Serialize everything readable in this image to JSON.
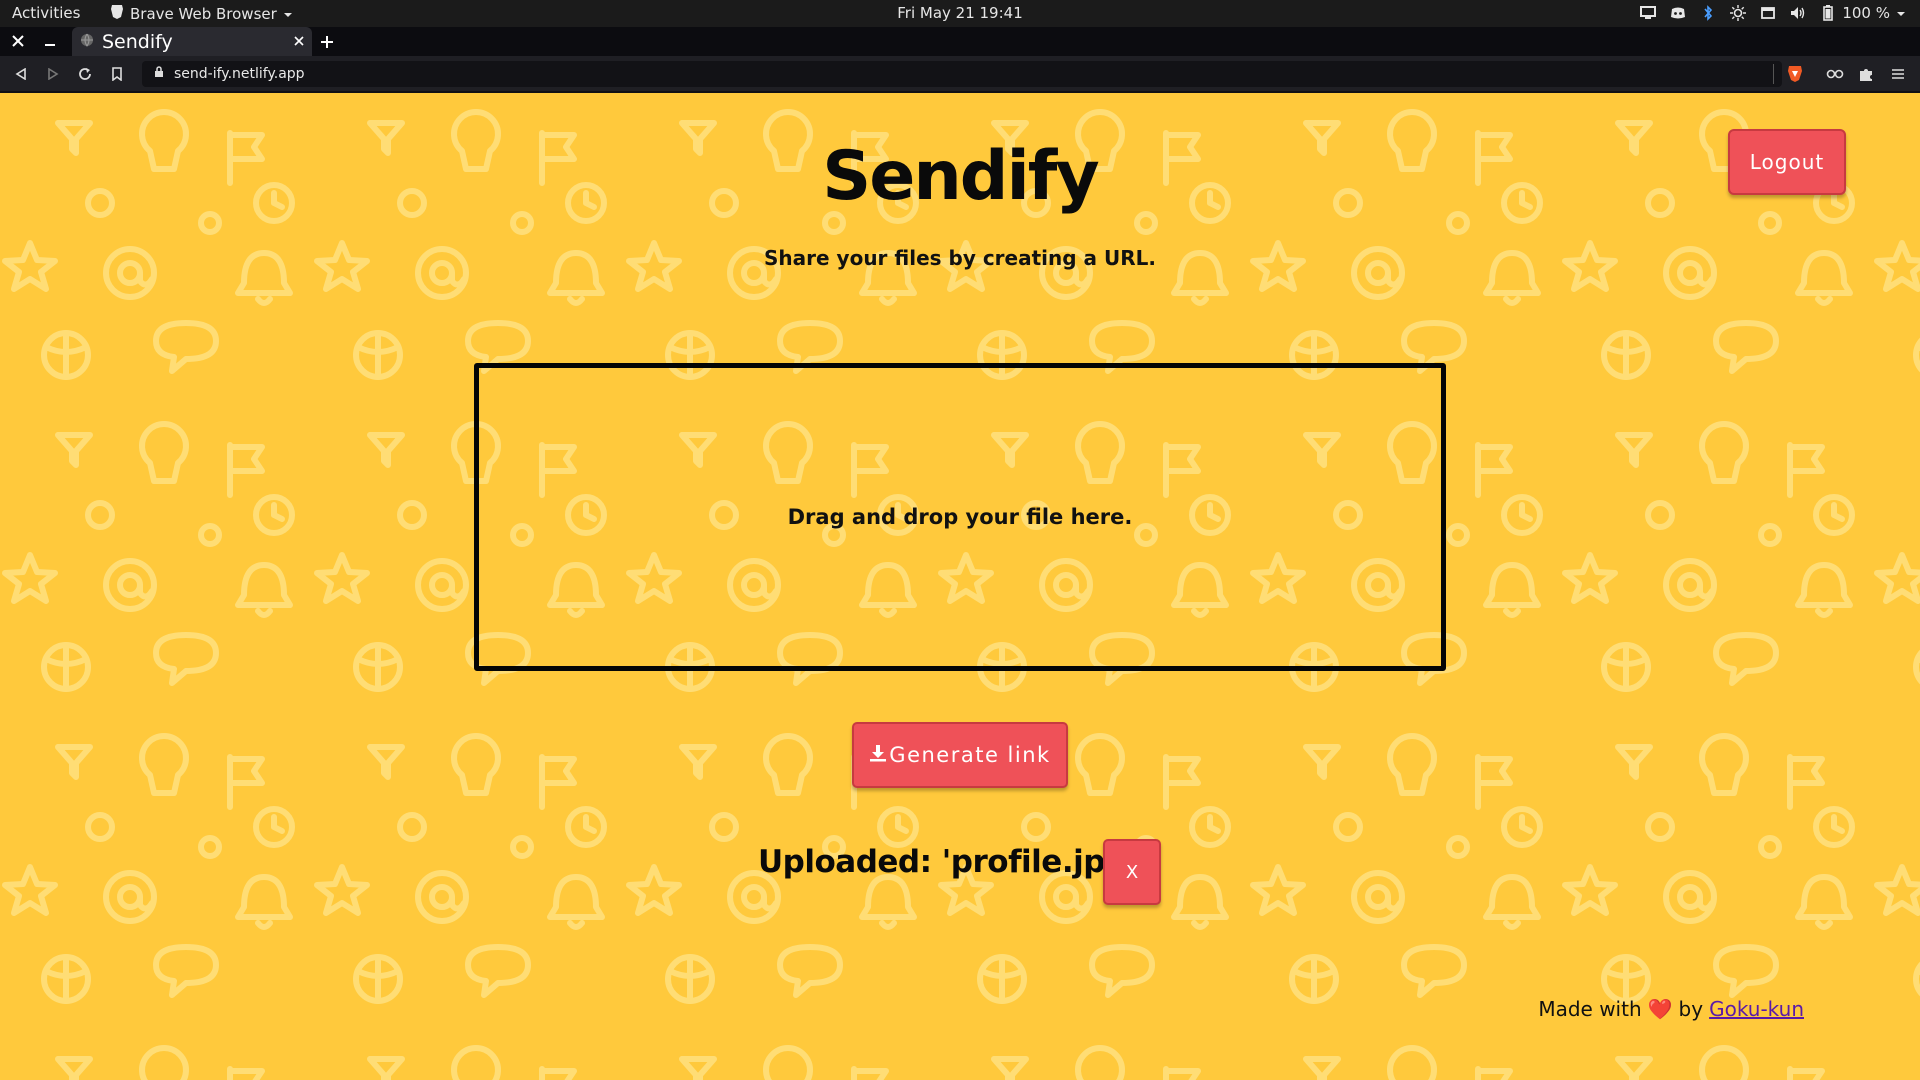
{
  "system_bar": {
    "activities": "Activities",
    "app_name": "Brave Web Browser",
    "clock": "Fri May 21  19:41",
    "battery": "100 %"
  },
  "browser": {
    "tab_title": "Sendify",
    "url": "send-ify.netlify.app"
  },
  "page": {
    "title": "Sendify",
    "subtitle": "Share your files by creating a URL.",
    "logout_label": "Logout",
    "dropzone_text": "Drag and drop your file here.",
    "generate_label": "Generate link",
    "uploaded_text": "Uploaded: 'profile.jpeg'",
    "remove_label": "X",
    "footer": {
      "prefix": "Made with",
      "heart": "❤️",
      "by": "by",
      "author": "Goku-kun"
    }
  },
  "colors": {
    "background": "#ffc93c",
    "button": "#ef5158",
    "text": "#0a0a0a"
  },
  "icons": [
    "brave-icon",
    "chevron-down-icon",
    "display-icon",
    "discord-icon",
    "bluetooth-icon",
    "brightness-icon",
    "window-icon",
    "volume-icon",
    "battery-icon",
    "close-icon",
    "minimize-icon",
    "plus-icon",
    "back-icon",
    "forward-icon",
    "reload-icon",
    "bookmark-icon",
    "lock-icon",
    "brave-shield-icon",
    "glasses-icon",
    "puzzle-icon",
    "menu-icon",
    "download-icon"
  ]
}
